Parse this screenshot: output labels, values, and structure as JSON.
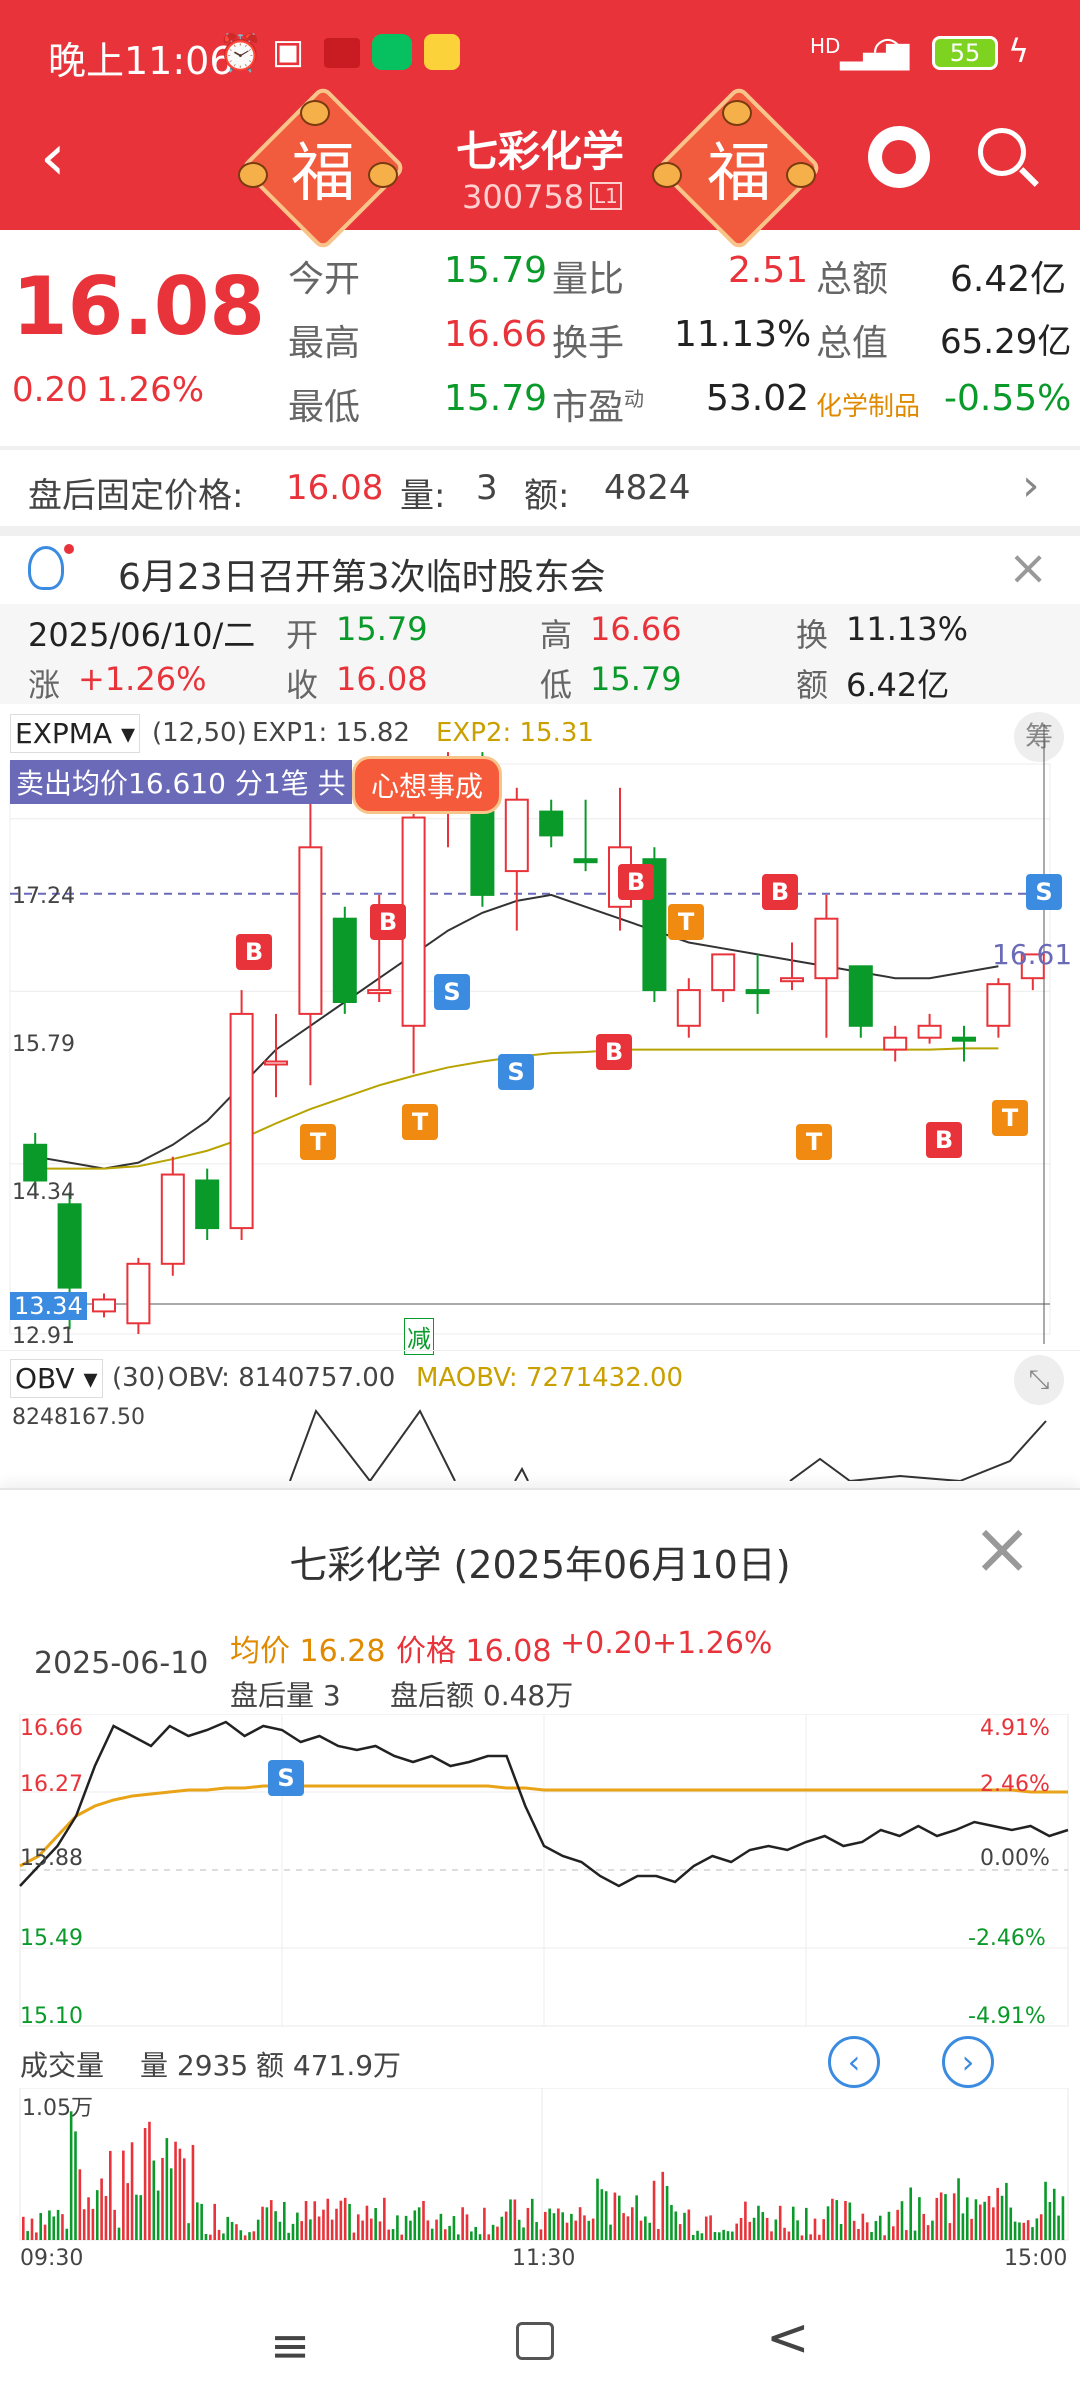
{
  "status_bar": {
    "time": "晚上11:06",
    "battery": "55",
    "network": "HD"
  },
  "header": {
    "stock_name": "七彩化学",
    "stock_code": "300758",
    "level": "L1",
    "fu_char": "福"
  },
  "quote": {
    "price": "16.08",
    "change": "0.20",
    "change_pct": "1.26%",
    "open_label": "今开",
    "open": "15.79",
    "high_label": "最高",
    "high": "16.66",
    "low_label": "最低",
    "low": "15.79",
    "vol_ratio_label": "量比",
    "vol_ratio": "2.51",
    "turnover_label": "换手",
    "turnover": "11.13%",
    "pe_label": "市盈",
    "pe_sup": "动",
    "pe": "53.02",
    "amount_label": "总额",
    "amount": "6.42亿",
    "mktcap_label": "总值",
    "mktcap": "65.29亿",
    "sector": "化学制品",
    "sector_pct": "-0.55%"
  },
  "after_hours": {
    "label": "盘后固定价格:",
    "price": "16.08",
    "vol_label": "量:",
    "vol": "3",
    "amt_label": "额:",
    "amt": "4824"
  },
  "notice": {
    "text": "6月23日召开第3次临时股东会"
  },
  "day_info": {
    "date": "2025/06/10/二",
    "open_label": "开",
    "open": "15.79",
    "high_label": "高",
    "high": "16.66",
    "turn_label": "换",
    "turn": "11.13%",
    "chg_label": "涨",
    "chg": "+1.26%",
    "close_label": "收",
    "close": "16.08",
    "low_label": "低",
    "low": "15.79",
    "amt_label": "额",
    "amt": "6.42亿"
  },
  "kline": {
    "indicator": "EXPMA",
    "params": "(12,50)",
    "exp1": "EXP1: 15.82",
    "exp2": "EXP2: 15.31",
    "chip_btn": "筹",
    "sell_banner": "卖出均价16.610 分1笔 共",
    "sticker": "心想事成",
    "y_labels": [
      "17.24",
      "15.79",
      "14.34",
      "13.34",
      "12.91"
    ],
    "price_tag": "16.61",
    "minus_tag": "减"
  },
  "obv": {
    "indicator": "OBV",
    "params": "(30)",
    "obv": "OBV: 8140757.00",
    "maobv": "MAOBV: 7271432.00",
    "y_label": "8248167.50"
  },
  "intraday": {
    "title": "七彩化学 (2025年06月10日)",
    "date": "2025-06-10",
    "avg": "均价 16.28",
    "price": "价格 16.08",
    "chg": "+0.20",
    "pct": "+1.26%",
    "ah_vol": "盘后量 3",
    "ah_amt": "盘后额 0.48万",
    "y_left": [
      "16.66",
      "16.27",
      "15.88",
      "15.49",
      "15.10"
    ],
    "y_right": [
      "4.91%",
      "2.46%",
      "0.00%",
      "-2.46%",
      "-4.91%"
    ],
    "vol_label": "成交量",
    "vol": "量 2935",
    "amt": "额 471.9万",
    "vol_max": "1.05万",
    "times": [
      "09:30",
      "11:30",
      "15:00"
    ]
  },
  "chart_data": [
    {
      "type": "candlestick",
      "title": "",
      "series": [
        {
          "name": "EXP1",
          "values": [
            14.4,
            14.35,
            14.3,
            14.35,
            14.5,
            14.7,
            15.0,
            15.3,
            15.5,
            15.7,
            15.9,
            16.1,
            16.3,
            16.45,
            16.55,
            16.6,
            16.5,
            16.4,
            16.3,
            16.2,
            16.15,
            16.1,
            16.05,
            16.0,
            15.95,
            15.9,
            15.9,
            15.95,
            16.0
          ]
        },
        {
          "name": "EXP2",
          "values": [
            14.3,
            14.3,
            14.3,
            14.32,
            14.38,
            14.45,
            14.55,
            14.68,
            14.8,
            14.9,
            15.0,
            15.08,
            15.15,
            15.2,
            15.24,
            15.27,
            15.28,
            15.3,
            15.3,
            15.3,
            15.3,
            15.3,
            15.3,
            15.3,
            15.3,
            15.3,
            15.3,
            15.31,
            15.31
          ]
        }
      ],
      "ylim": [
        12.91,
        17.7
      ]
    },
    {
      "type": "line",
      "series": [
        {
          "name": "价格"
        },
        {
          "name": "均价"
        }
      ],
      "ylim": [
        15.1,
        16.66
      ],
      "x": [
        "09:30",
        "11:30",
        "15:00"
      ]
    },
    {
      "type": "bar",
      "title": "成交量",
      "ylim": [
        0,
        10500
      ]
    }
  ],
  "nav": {
    "menu": "≡",
    "home": "□",
    "back": "<"
  }
}
